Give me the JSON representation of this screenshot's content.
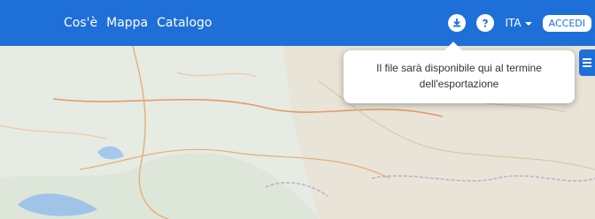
{
  "nav": {
    "items": [
      "Cos'è",
      "Mappa",
      "Catalogo"
    ]
  },
  "header": {
    "language": "ITA",
    "login_label": "ACCEDI"
  },
  "tooltip": {
    "text": "Il file sarà disponibile qui al termine dell'esportazione"
  },
  "icons": {
    "download": "download-icon",
    "help": "help-icon",
    "menu": "hamburger-menu-icon"
  },
  "colors": {
    "brand": "#1f6fd8",
    "map_background": "#e6ebe3"
  }
}
